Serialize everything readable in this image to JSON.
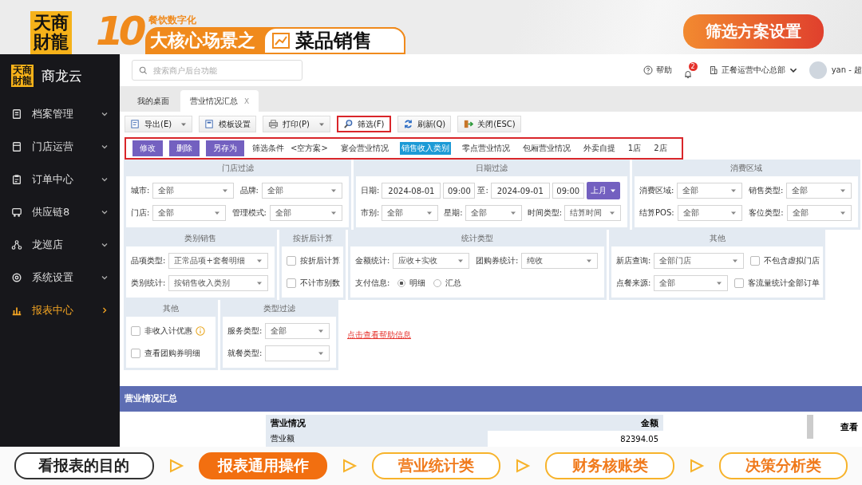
{
  "banner": {
    "logo": "天商財龍",
    "number": "10",
    "subtitle": "餐饮数字化",
    "title_prefix": "大核心场景之",
    "title": "菜品销售",
    "action": "筛选方案设置"
  },
  "sidebar": {
    "logo": "天商財龍",
    "brand": "商龙云",
    "items": [
      {
        "label": "档案管理",
        "kind": "document",
        "selected": false
      },
      {
        "label": "门店运营",
        "kind": "store",
        "selected": false
      },
      {
        "label": "订单中心",
        "kind": "clipboard",
        "selected": false
      },
      {
        "label": "供应链8",
        "kind": "truck",
        "selected": false
      },
      {
        "label": "龙巡店",
        "kind": "network",
        "selected": false
      },
      {
        "label": "系统设置",
        "kind": "gear",
        "selected": false
      },
      {
        "label": "报表中心",
        "kind": "chart",
        "selected": true
      }
    ]
  },
  "header": {
    "search_placeholder": "搜索商户后台功能",
    "help": "帮助",
    "notifications": "2",
    "org": "正餐运营中心总部",
    "user": "yan - 超"
  },
  "tabs": [
    {
      "label": "我的桌面",
      "selected": false
    },
    {
      "label": "营业情况汇总",
      "selected": true,
      "close": "X"
    }
  ],
  "toolbar": [
    {
      "kind": "export",
      "label": "导出(E)",
      "menu": true,
      "highlighted": false
    },
    {
      "kind": "template",
      "label": "模板设置",
      "menu": false,
      "highlighted": false
    },
    {
      "kind": "print",
      "label": "打印(P)",
      "menu": true,
      "highlighted": false
    },
    {
      "kind": "filter",
      "label": "筛选(F)",
      "menu": false,
      "highlighted": true
    },
    {
      "kind": "refresh",
      "label": "刷新(Q)",
      "menu": false,
      "highlighted": false
    },
    {
      "kind": "exit",
      "label": "关闭(ESC)",
      "menu": false,
      "highlighted": false
    }
  ],
  "scheme_bar": {
    "highlighted": true,
    "actions": [
      "修改",
      "删除",
      "另存为"
    ],
    "label": "筛选条件",
    "schemes": [
      {
        "label": "<空方案>",
        "selected": false
      },
      {
        "label": "宴会营业情况",
        "selected": false
      },
      {
        "label": "销售收入类别",
        "selected": true
      },
      {
        "label": "零点营业情况",
        "selected": false
      },
      {
        "label": "包厢营业情况",
        "selected": false
      },
      {
        "label": "外卖自提",
        "selected": false
      },
      {
        "label": "1店",
        "selected": false
      },
      {
        "label": "2店",
        "selected": false
      }
    ]
  },
  "filter_rows": [
    [
      {
        "title": "门店过滤",
        "rows": [
          [
            {
              "kind": "select",
              "label": "城市:",
              "value": "全部"
            },
            {
              "kind": "select",
              "label": "品牌:",
              "value": "全部"
            }
          ],
          [
            {
              "kind": "select",
              "label": "门店:",
              "value": "全部"
            },
            {
              "kind": "select",
              "label": "管理模式:",
              "value": "全部"
            }
          ]
        ]
      },
      {
        "title": "日期过滤",
        "rows": [
          [
            {
              "kind": "input",
              "label": "日期:",
              "value": "2024-08-01"
            },
            {
              "kind": "input",
              "value": "09:00"
            },
            {
              "kind": "input",
              "label": "至:",
              "value": "2024-09-01"
            },
            {
              "kind": "input",
              "value": "09:00"
            },
            {
              "kind": "dropbutton",
              "value": "上月"
            }
          ],
          [
            {
              "kind": "select",
              "label": "市别:",
              "value": "全部"
            },
            {
              "kind": "select",
              "label": "星期:",
              "value": "全部"
            },
            {
              "kind": "select",
              "label": "时间类型:",
              "value": "结算时间"
            }
          ]
        ]
      },
      {
        "title": "消费区域",
        "rows": [
          [
            {
              "kind": "select",
              "label": "消费区域:",
              "value": "全部"
            },
            {
              "kind": "select",
              "label": "销售类型:",
              "value": "全部"
            }
          ],
          [
            {
              "kind": "select",
              "label": "结算POS:",
              "value": "全部"
            },
            {
              "kind": "select",
              "label": "客位类型:",
              "value": "全部"
            }
          ]
        ]
      }
    ],
    [
      {
        "title": "类别销售",
        "rows": [
          [
            {
              "kind": "select",
              "label": "品项类型:",
              "value": "正常品项+套餐明细"
            }
          ],
          [
            {
              "kind": "select",
              "label": "类别统计:",
              "value": "按销售收入类别"
            }
          ]
        ]
      },
      {
        "title": "按折后计算",
        "rows": [
          [
            {
              "kind": "checkbox",
              "label": "按折后计算",
              "checked": false
            }
          ],
          [
            {
              "kind": "checkbox",
              "label": "不计市别数",
              "checked": false
            }
          ]
        ]
      },
      {
        "title": "统计类型",
        "rows": [
          [
            {
              "kind": "select",
              "label": "金额统计:",
              "value": "应收+实收"
            },
            {
              "kind": "select",
              "label": "团购券统计:",
              "value": "纯收"
            }
          ],
          [
            {
              "kind": "radios",
              "label": "支付信息:",
              "options": [
                {
                  "label": "明细",
                  "selected": true
                },
                {
                  "label": "汇总",
                  "selected": false
                }
              ]
            }
          ]
        ]
      },
      {
        "title": "其他",
        "rows": [
          [
            {
              "kind": "select",
              "label": "新店查询:",
              "value": "全部门店"
            },
            {
              "kind": "checkbox",
              "label": "不包含虚拟门店",
              "checked": false
            }
          ],
          [
            {
              "kind": "select",
              "label": "点餐来源:",
              "value": "全部"
            },
            {
              "kind": "checkbox",
              "label": "客流量统计全部订单",
              "checked": false
            }
          ]
        ]
      }
    ],
    [
      {
        "title": "其他",
        "rows": [
          [
            {
              "kind": "checkbox",
              "label": "非收入计优惠",
              "checked": false,
              "hint_icon": true
            }
          ],
          [
            {
              "kind": "checkbox",
              "label": "查看团购券明细",
              "checked": false
            }
          ]
        ]
      },
      {
        "title": "类型过滤",
        "rows": [
          [
            {
              "kind": "select",
              "label": "服务类型:",
              "value": "全部"
            }
          ],
          [
            {
              "kind": "select",
              "label": "就餐类型:"
            }
          ]
        ]
      }
    ]
  ],
  "help_link": "点击查看帮助信息",
  "summary": {
    "title": "营业情况汇总",
    "columns": [
      "营业情况",
      "金额"
    ],
    "rows": [
      [
        "营业额",
        "82394.05"
      ]
    ],
    "side_text": "查看"
  },
  "steps": [
    {
      "label": "看报表的目的",
      "kind": "intro",
      "selected": false
    },
    {
      "label": "报表通用操作",
      "kind": "topic",
      "selected": true
    },
    {
      "label": "营业统计类",
      "kind": "topic",
      "selected": false
    },
    {
      "label": "财务核账类",
      "kind": "topic",
      "selected": false
    },
    {
      "label": "决策分析类",
      "kind": "topic",
      "selected": false
    }
  ]
}
